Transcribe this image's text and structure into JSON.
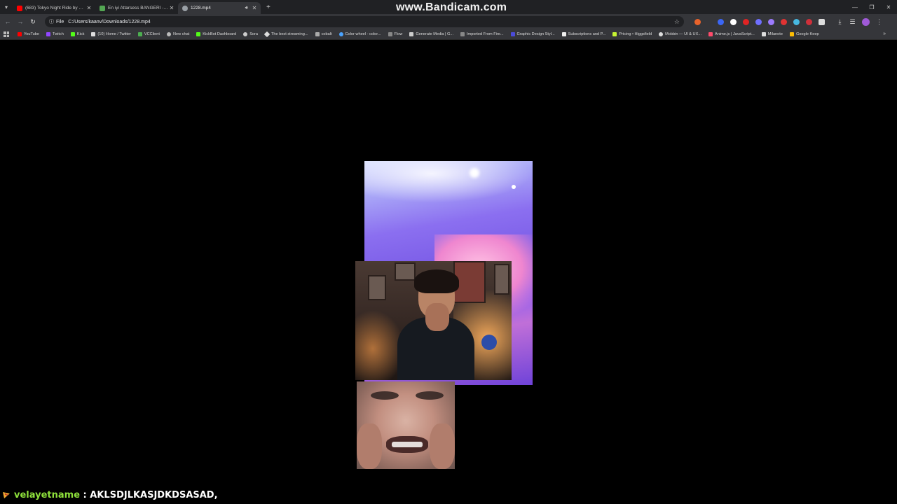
{
  "browser": {
    "tabs": [
      {
        "title": "(683) Tokyo Night Ride by Nin...",
        "favicon_color": "#ff0000",
        "active": false,
        "audio": false
      },
      {
        "title": "En iyi Attarsess BANGERI - Tier...",
        "favicon_color": "#53a653",
        "active": false,
        "audio": false
      },
      {
        "title": "1228.mp4",
        "favicon_color": "#9aa0a6",
        "active": true,
        "audio": true
      }
    ],
    "watermark": "www.Bandicam.com",
    "address": {
      "scheme_label": "File",
      "url": "C:/Users/kaanv/Downloads/1228.mp4"
    },
    "extension_colors": [
      "#e8632b",
      "#3b66f5",
      "#ffffff",
      "#e02424",
      "#6f6fff",
      "#9c7bff",
      "#e03333",
      "#47b8e0",
      "#d0303a",
      "#dddddd"
    ],
    "bookmarks": [
      {
        "label": "YouTube",
        "icon_color": "#ff0000"
      },
      {
        "label": "Twitch",
        "icon_color": "#9146ff"
      },
      {
        "label": "Kick",
        "icon_color": "#53fc18"
      },
      {
        "label": "(10) Home / Twitter",
        "icon_color": "#dddddd"
      },
      {
        "label": "VCClient",
        "icon_color": "#4caf50"
      },
      {
        "label": "New chat",
        "icon_color": "#bbbbbb"
      },
      {
        "label": "KickBot Dashboard",
        "icon_color": "#53fc18"
      },
      {
        "label": "Sora",
        "icon_color": "#cccccc"
      },
      {
        "label": "The best streaming...",
        "icon_color": "#dddddd"
      },
      {
        "label": "cobalt",
        "icon_color": "#aaaaaa"
      },
      {
        "label": "Color wheel - color...",
        "icon_color": "#4aa3ff"
      },
      {
        "label": "Flow",
        "icon_color": "#888888"
      },
      {
        "label": "Generate Media | G...",
        "icon_color": "#cccccc"
      },
      {
        "label": "Imported From Fire...",
        "icon_color": "#888888"
      },
      {
        "label": "Graphic Design Styl...",
        "icon_color": "#4b4bd8"
      },
      {
        "label": "Subscriptions and P...",
        "icon_color": "#eeeeee"
      },
      {
        "label": "Pricing • Higgsfield",
        "icon_color": "#c6f432"
      },
      {
        "label": "Mobbin — UI & UX...",
        "icon_color": "#dddddd"
      },
      {
        "label": "Anime.js | JavaScript...",
        "icon_color": "#ff4b6b"
      },
      {
        "label": "Milanote",
        "icon_color": "#dddddd"
      },
      {
        "label": "Google Keep",
        "icon_color": "#fbbc04"
      }
    ]
  },
  "chat": {
    "username": "velayetname",
    "separator": " : ",
    "message": "AKLSDJLKASJDKDSASAD,",
    "username_color": "#8ee03b"
  }
}
